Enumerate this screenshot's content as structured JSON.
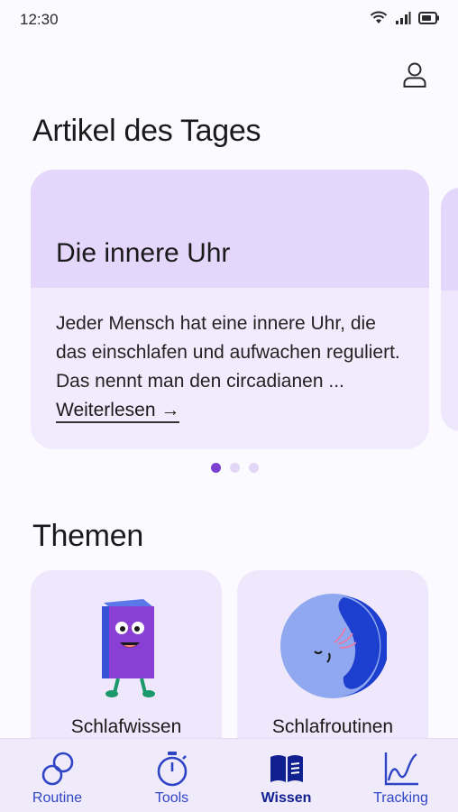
{
  "status_bar": {
    "time": "12:30"
  },
  "header": {
    "profile_icon": "person-icon"
  },
  "article_section": {
    "title": "Artikel des Tages",
    "card": {
      "title": "Die innere Uhr",
      "excerpt": "Jeder Mensch hat eine innere Uhr, die das einschlafen und aufwachen reguliert. Das nennt man den circadianen ... ",
      "read_more": "Weiterlesen →"
    },
    "pager": {
      "count": 3,
      "active": 1
    }
  },
  "topics_section": {
    "title": "Themen",
    "items": [
      {
        "label": "Schlafwissen",
        "icon": "book-character-icon"
      },
      {
        "label": "Schlafroutinen",
        "icon": "moon-face-icon"
      }
    ]
  },
  "bottom_nav": {
    "items": [
      {
        "label": "Routine",
        "icon": "rings-icon",
        "active": false
      },
      {
        "label": "Tools",
        "icon": "stopwatch-icon",
        "active": false
      },
      {
        "label": "Wissen",
        "icon": "open-book-icon",
        "active": true
      },
      {
        "label": "Tracking",
        "icon": "chart-icon",
        "active": false
      }
    ]
  },
  "colors": {
    "background": "#fbfaff",
    "card_head": "#e4d7fb",
    "card_body": "#f1ebfd",
    "accent": "#7c3fd0",
    "nav_text": "#2f45c6",
    "nav_active": "#102091"
  }
}
